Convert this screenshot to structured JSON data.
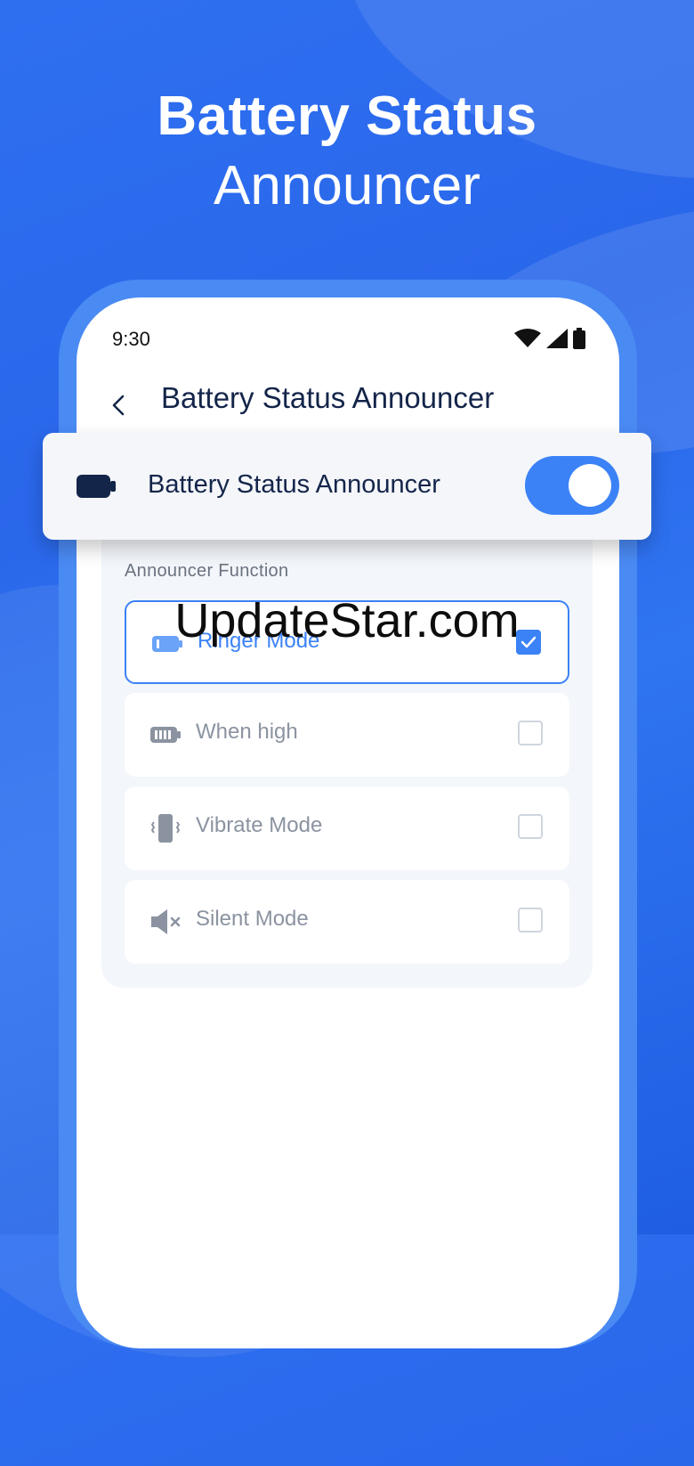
{
  "headline": {
    "line1": "Battery Status",
    "line2": "Announcer"
  },
  "status_bar": {
    "time": "9:30",
    "icons": [
      "wifi-icon",
      "signal-icon",
      "battery-icon"
    ]
  },
  "app_bar": {
    "back_icon": "chevron-left-icon",
    "title": "Battery Status Announcer"
  },
  "master_toggle": {
    "icon": "battery-icon",
    "label": "Battery Status Announcer",
    "enabled": true
  },
  "announcer_function": {
    "section_label": "Announcer Function",
    "options": [
      {
        "icon": "battery-icon",
        "label": "Ringer Mode",
        "checked": true
      },
      {
        "icon": "battery-full-icon",
        "label": "When high",
        "checked": false
      },
      {
        "icon": "vibrate-icon",
        "label": "Vibrate Mode",
        "checked": false
      },
      {
        "icon": "speaker-mute-icon",
        "label": "Silent Mode",
        "checked": false
      }
    ]
  },
  "watermark": "UpdateStar.com",
  "colors": {
    "background": "#2e6ff0",
    "accent": "#3b82f6",
    "title_text": "#14254a",
    "muted_text": "#8b93a1"
  }
}
